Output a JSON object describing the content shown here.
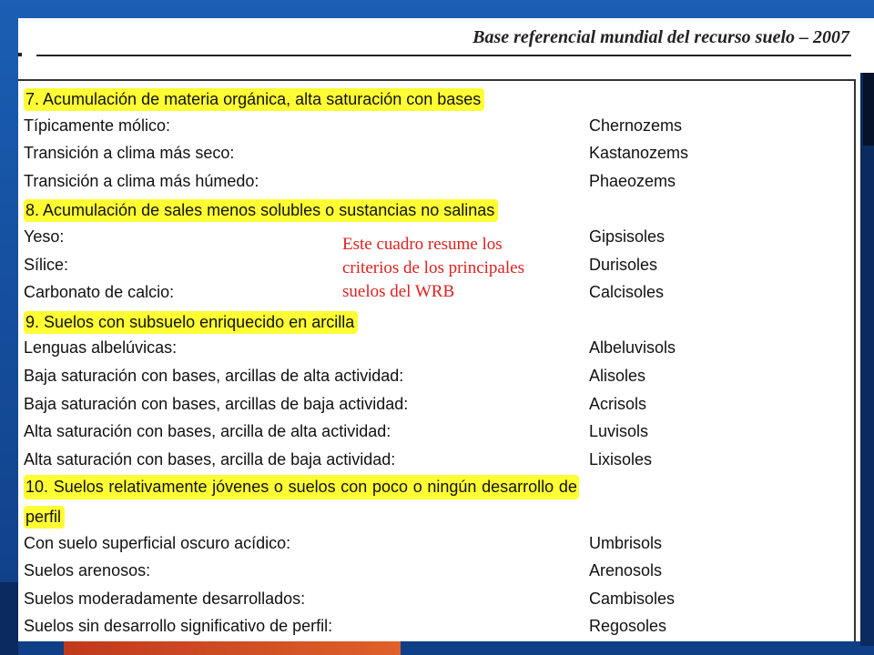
{
  "header": {
    "title": "Base referencial mundial del recurso suelo – 2007"
  },
  "annotation": {
    "lines": [
      "Este cuadro resume los",
      "criterios de los principales",
      "suelos del WRB"
    ]
  },
  "rows": [
    {
      "type": "heading",
      "text": "7. Acumulación de materia orgánica, alta saturación con bases"
    },
    {
      "type": "item",
      "criterion": "Típicamente mólico:",
      "group": "Chernozems"
    },
    {
      "type": "item",
      "criterion": "Transición a clima más seco:",
      "group": "Kastanozems"
    },
    {
      "type": "item",
      "criterion": "Transición a clima más húmedo:",
      "group": "Phaeozems"
    },
    {
      "type": "heading",
      "text": "8. Acumulación de sales menos solubles o sustancias no salinas"
    },
    {
      "type": "item",
      "criterion": "Yeso:",
      "group": "Gipsisoles"
    },
    {
      "type": "item",
      "criterion": "Sílice:",
      "group": "Durisoles"
    },
    {
      "type": "item",
      "criterion": "Carbonato de calcio:",
      "group": "Calcisoles"
    },
    {
      "type": "heading",
      "text": "9. Suelos con subsuelo enriquecido en arcilla"
    },
    {
      "type": "item",
      "criterion": "Lenguas albelúvicas:",
      "group": "Albeluvisols"
    },
    {
      "type": "item",
      "criterion": "Baja saturación con bases, arcillas de alta actividad:",
      "group": "Alisoles"
    },
    {
      "type": "item",
      "criterion": "Baja saturación con bases, arcillas de baja actividad:",
      "group": "Acrisols"
    },
    {
      "type": "item",
      "criterion": "Alta saturación con bases, arcilla de alta actividad:",
      "group": "Luvisols"
    },
    {
      "type": "item",
      "criterion": "Alta saturación con bases, arcilla de baja actividad:",
      "group": "Lixisoles"
    },
    {
      "type": "heading-wide",
      "words": [
        "10.",
        "Suelos",
        "relativamente",
        "jóvenes",
        "o",
        "suelos",
        "con",
        "poco",
        "o",
        "ningún",
        "desarrollo",
        "de"
      ]
    },
    {
      "type": "heading",
      "text": "perfil"
    },
    {
      "type": "item",
      "criterion": "Con suelo superficial oscuro acídico:",
      "group": "Umbrisols"
    },
    {
      "type": "item",
      "criterion": "Suelos arenosos:",
      "group": "Arenosols"
    },
    {
      "type": "item",
      "criterion": "Suelos moderadamente desarrollados:",
      "group": "Cambisoles"
    },
    {
      "type": "item",
      "criterion": "Suelos sin desarrollo significativo de perfil:",
      "group": "Regosoles"
    }
  ]
}
